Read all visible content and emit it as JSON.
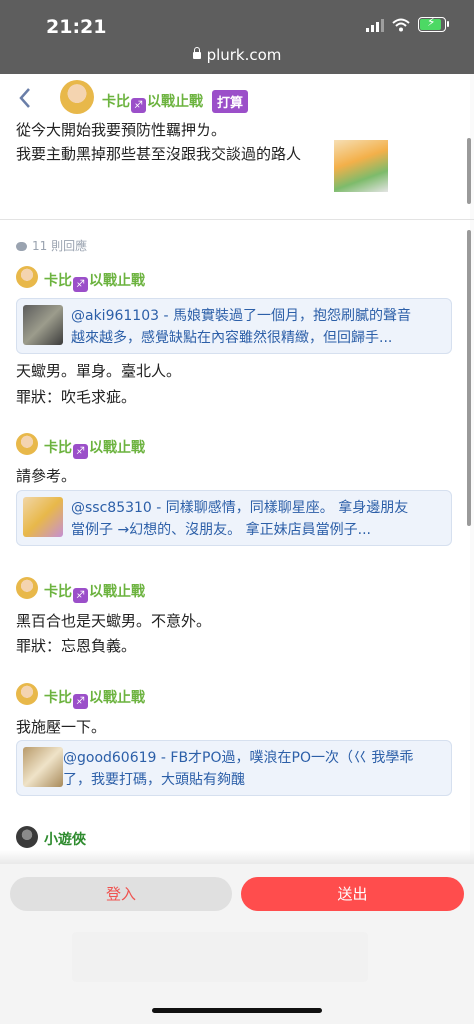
{
  "status_bar": {
    "time": "21:21",
    "url": "plurk.com"
  },
  "post": {
    "author": "卡比",
    "author_suffix": "以戰止戰",
    "zodiac_glyph": "♐",
    "qualifier": "打算",
    "lines": [
      "從今大開始我要預防性羈押ㄌ。",
      "我要主動黑掉那些甚至沒跟我交談過的路人"
    ]
  },
  "responses_count": "11 則回應",
  "responses": [
    {
      "author": "卡比",
      "author_suffix": "以戰止戰",
      "card": [
        "@aki961103 - 馬娘實裝過了一個月，抱怨刷膩的聲音",
        "越來越多，感覺缺點在內容雖然很精緻，但回歸手..."
      ],
      "lines": [
        "天蠍男。單身。臺北人。",
        "罪狀：吹毛求疵。"
      ]
    },
    {
      "author": "卡比",
      "author_suffix": "以戰止戰",
      "lines": [
        "請參考。"
      ],
      "card": [
        "@ssc85310 - 同樣聊感情，同樣聊星座。 拿身邊朋友",
        "當例子 →幻想的、沒朋友。 拿正妹店員當例子..."
      ]
    },
    {
      "author": "卡比",
      "author_suffix": "以戰止戰",
      "lines": [
        "黑百合也是天蠍男。不意外。",
        "罪狀：忘恩負義。"
      ]
    },
    {
      "author": "卡比",
      "author_suffix": "以戰止戰",
      "lines": [
        "我施壓一下。"
      ],
      "card": [
        "@good60619 - FB才PO過，噗浪在PO一次（巜 我學乖",
        "了，我要打碼，大頭貼有夠醜"
      ]
    },
    {
      "author": "小遊俠"
    }
  ],
  "actions": {
    "login": "登入",
    "send": "送出"
  },
  "colors": {
    "name_green": "#6cb33f",
    "send_red": "#ff4d4d",
    "link_blue": "#2c5fa8",
    "zodiac_purple": "#9b4fc9"
  }
}
